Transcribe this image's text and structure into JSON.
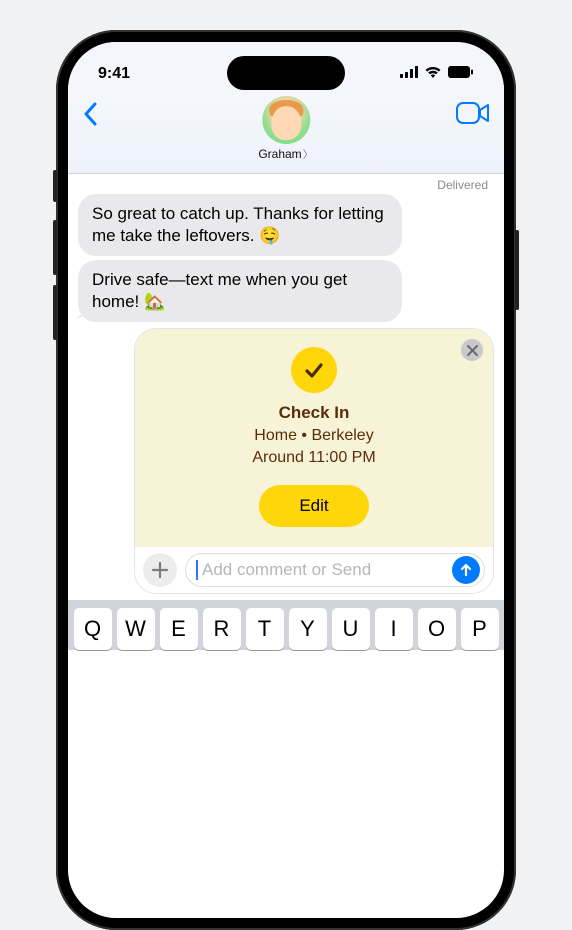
{
  "status": {
    "time": "9:41"
  },
  "header": {
    "contact_name": "Graham"
  },
  "thread": {
    "delivered_label": "Delivered",
    "messages": [
      "So great to catch up. Thanks for letting me take the leftovers. 🤤",
      "Drive safe—text me when you get home! 🏡"
    ]
  },
  "checkin": {
    "title": "Check In",
    "line1": "Home • Berkeley",
    "line2": "Around 11:00 PM",
    "edit_label": "Edit"
  },
  "input": {
    "placeholder": "Add comment or Send"
  },
  "keyboard": {
    "row1": [
      "Q",
      "W",
      "E",
      "R",
      "T",
      "Y",
      "U",
      "I",
      "O",
      "P"
    ]
  }
}
